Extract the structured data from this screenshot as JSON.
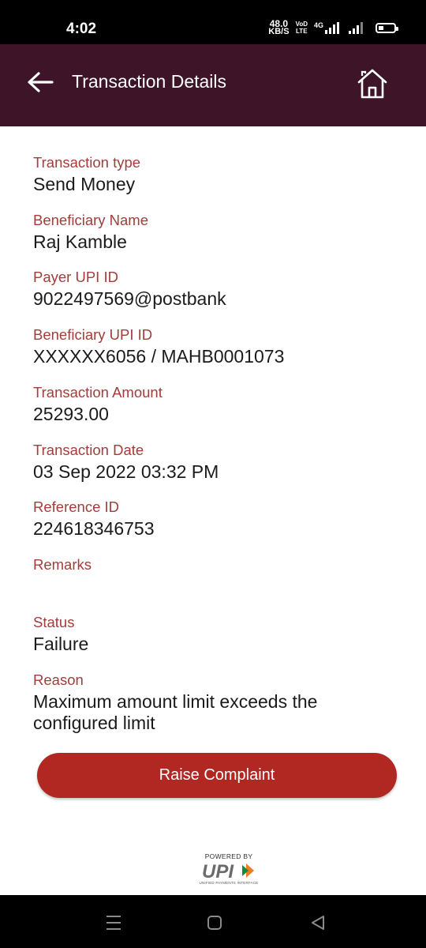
{
  "status_bar": {
    "time": "4:02",
    "net_speed_value": "48.0",
    "net_speed_unit": "KB/S",
    "volte_top": "VoD",
    "volte_bottom": "LTE",
    "network_type": "4G"
  },
  "app_bar": {
    "title": "Transaction Details"
  },
  "details": [
    {
      "label": "Transaction type",
      "value": "Send Money"
    },
    {
      "label": "Beneficiary Name",
      "value": "Raj Kamble"
    },
    {
      "label": "Payer UPI ID",
      "value": "9022497569@postbank"
    },
    {
      "label": "Beneficiary UPI ID",
      "value": "XXXXXX6056 / MAHB0001073"
    },
    {
      "label": "Transaction Amount",
      "value": "25293.00"
    },
    {
      "label": "Transaction Date",
      "value": "03 Sep 2022 03:32 PM"
    },
    {
      "label": "Reference ID",
      "value": "224618346753"
    },
    {
      "label": "Remarks",
      "value": ""
    },
    {
      "label": "Status",
      "value": "Failure"
    },
    {
      "label": "Reason",
      "value": "Maximum amount limit exceeds the configured limit"
    }
  ],
  "raise_complaint_label": "Raise Complaint",
  "upi_logo": {
    "powered_by": "POWERED BY",
    "wordmark": "UPI",
    "tagline": "UNIFIED PAYMENTS INTERFACE"
  },
  "colors": {
    "app_bar": "#3e1428",
    "label": "#a23d3a",
    "button": "#b12722"
  }
}
